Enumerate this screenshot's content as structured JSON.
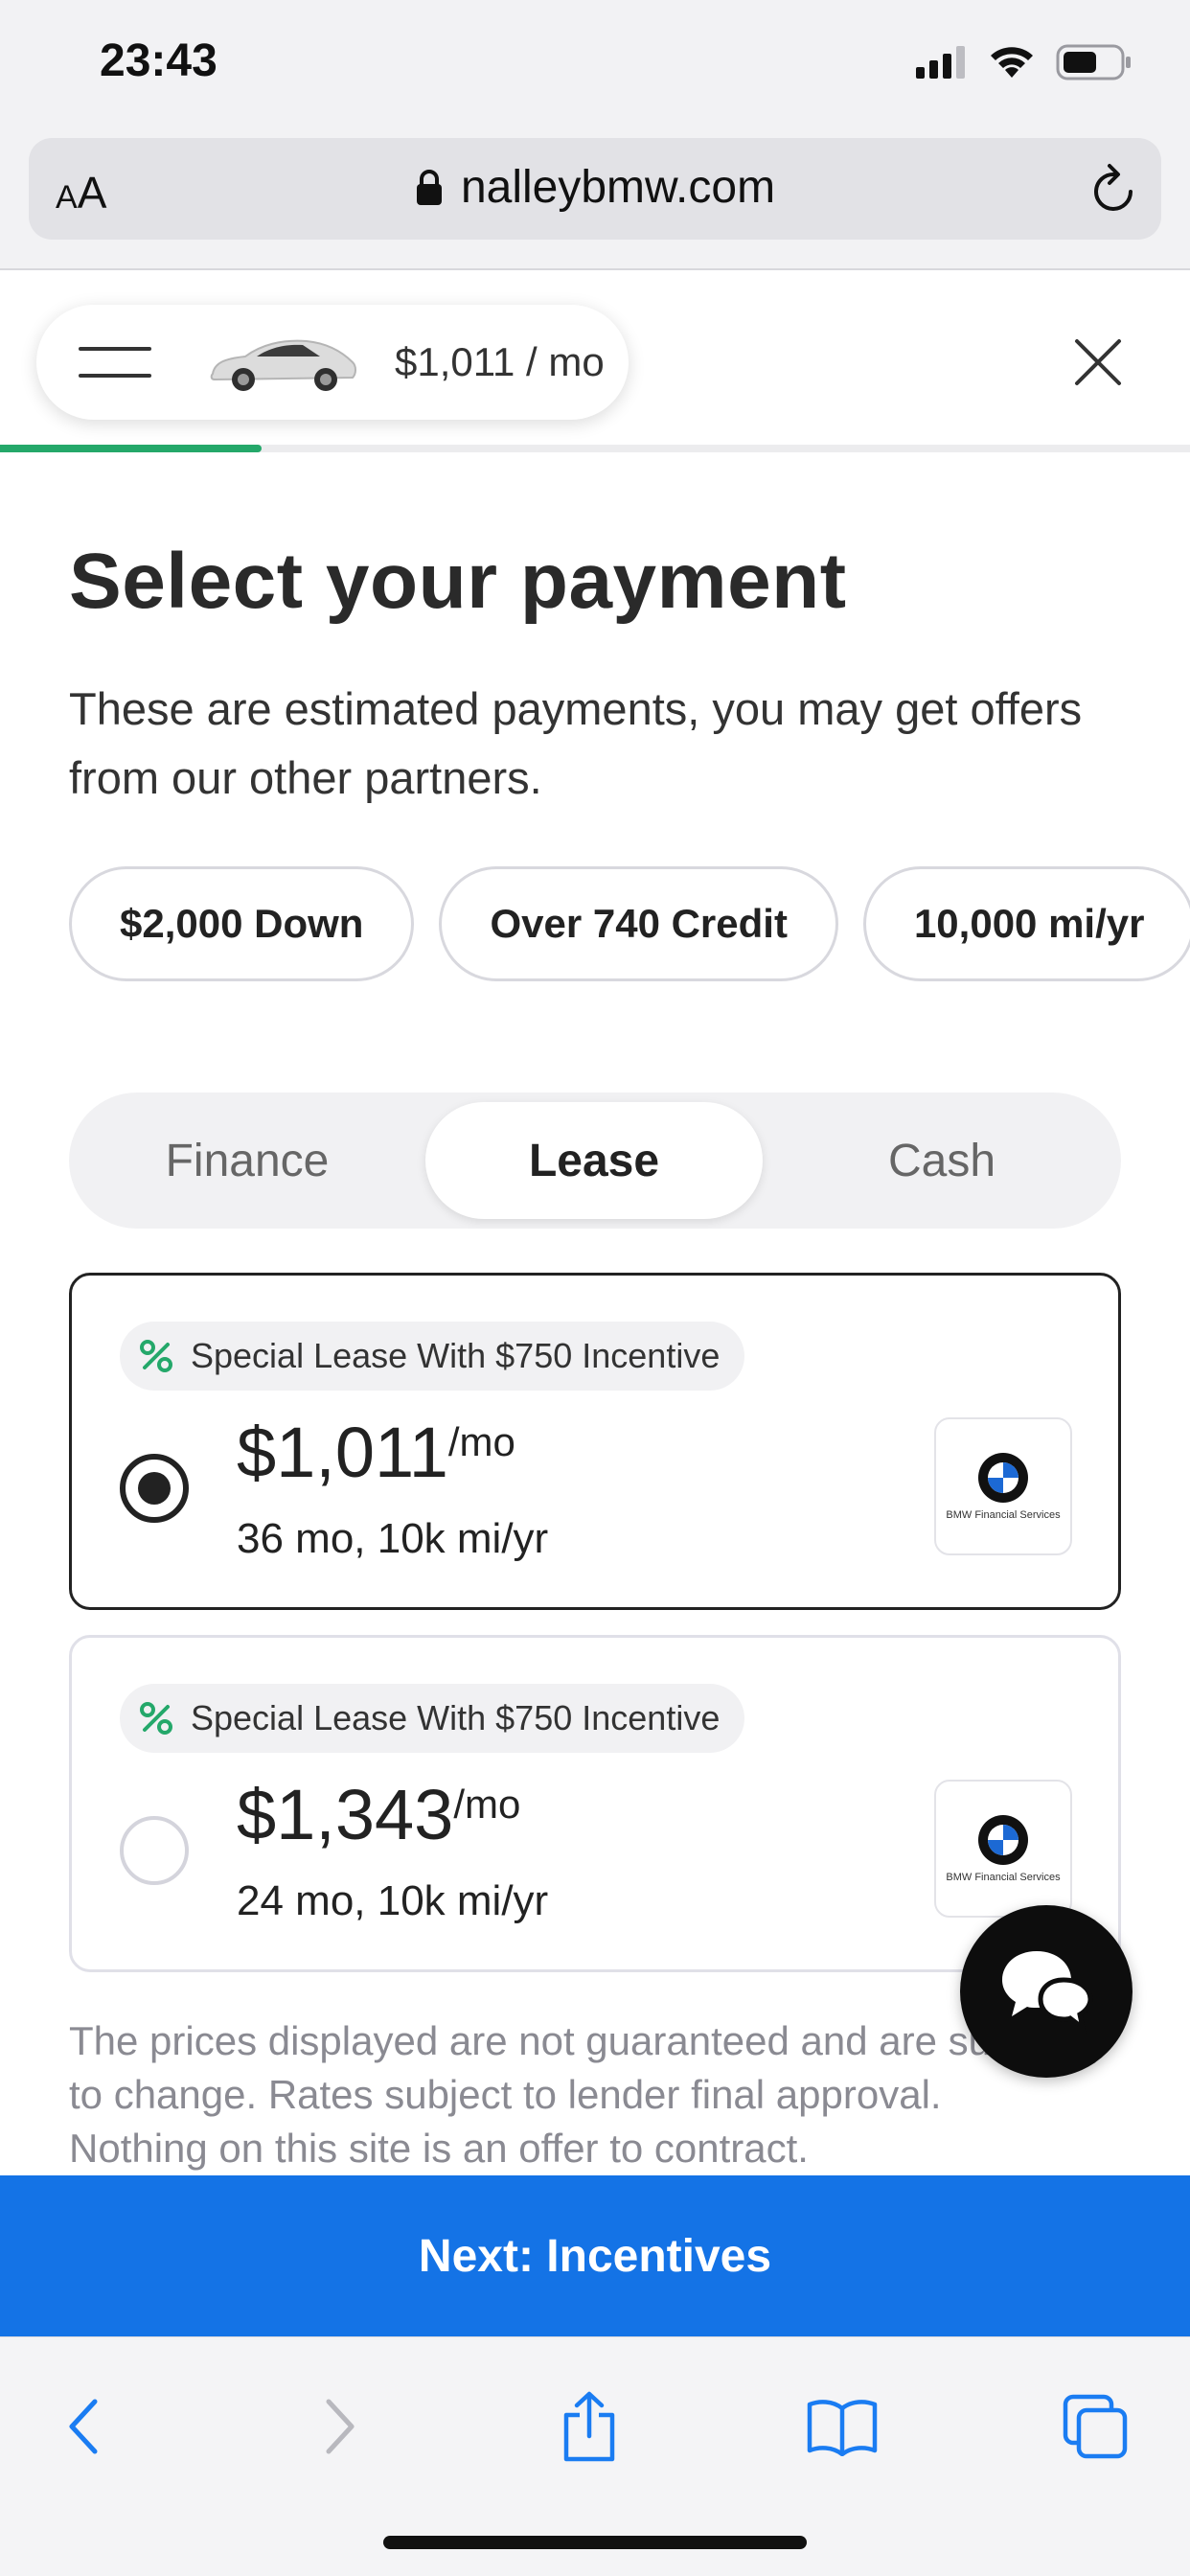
{
  "status_bar": {
    "time": "23:43"
  },
  "browser": {
    "text_size_label": "A",
    "text_size_label_big": "A",
    "url": "nalleybmw.com"
  },
  "header": {
    "monthly_summary": "$1,011 / mo"
  },
  "progress": {
    "fraction": 0.22,
    "color": "#24a86a"
  },
  "page": {
    "title": "Select your payment",
    "subtitle": "These are estimated payments, you may get offers from our other partners."
  },
  "filters": [
    {
      "label": "$2,000 Down"
    },
    {
      "label": "Over 740 Credit"
    },
    {
      "label": "10,000 mi/yr"
    }
  ],
  "payment_types": [
    {
      "label": "Finance",
      "active": false
    },
    {
      "label": "Lease",
      "active": true
    },
    {
      "label": "Cash",
      "active": false
    }
  ],
  "options": [
    {
      "badge": "Special Lease With $750 Incentive",
      "price": "$1,011",
      "per": "/mo",
      "terms": "36 mo, 10k mi/yr",
      "lender": "BMW Financial Services",
      "selected": true
    },
    {
      "badge": "Special Lease With $750 Incentive",
      "price": "$1,343",
      "per": "/mo",
      "terms": "24 mo, 10k mi/yr",
      "lender": "BMW Financial Services",
      "selected": false
    }
  ],
  "disclaimer": "The prices displayed are not guaranteed and are subject to change. Rates subject to lender final approval. Nothing on this site is an offer to contract.",
  "cta": {
    "label": "Next: Incentives",
    "color": "#1473e6"
  },
  "colors": {
    "accent_green": "#24a86a",
    "primary_blue": "#1473e6",
    "safari_blue": "#1a7cf2"
  },
  "icons": {
    "status": [
      "cellular-signal-icon",
      "wifi-icon",
      "battery-icon"
    ],
    "toolbar": [
      "back-icon",
      "forward-icon",
      "share-icon",
      "bookmarks-icon",
      "tabs-icon"
    ]
  }
}
